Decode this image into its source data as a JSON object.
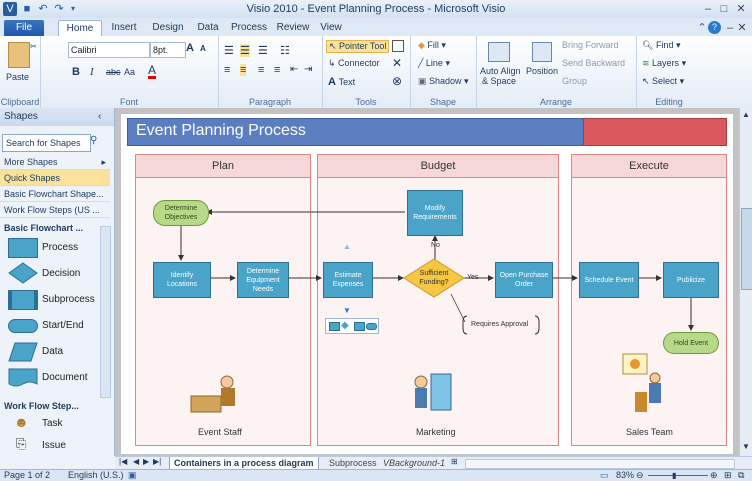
{
  "window": {
    "title": "Visio 2010 - Event Planning Process - Microsoft Visio"
  },
  "ribbon_tabs": [
    "File",
    "Home",
    "Insert",
    "Design",
    "Data",
    "Process",
    "Review",
    "View"
  ],
  "ribbon": {
    "clipboard": {
      "label": "Clipboard",
      "paste": "Paste"
    },
    "font": {
      "label": "Font",
      "family": "Calibri",
      "size": "8pt.",
      "bold": "B",
      "italic": "I",
      "strike": "abc",
      "case": "Aa",
      "color": "A",
      "grow": "A",
      "shrink": "A"
    },
    "paragraph": {
      "label": "Paragraph"
    },
    "tools": {
      "label": "Tools",
      "pointer": "Pointer Tool",
      "connector": "Connector",
      "text": "Text"
    },
    "shape": {
      "label": "Shape",
      "fill": "Fill",
      "line": "Line",
      "shadow": "Shadow"
    },
    "arrange": {
      "label": "Arrange",
      "auto_align": "Auto Align",
      "auto_align2": "& Space",
      "position": "Position",
      "bring_forward": "Bring Forward",
      "send_backward": "Send Backward",
      "group": "Group"
    },
    "editing": {
      "label": "Editing",
      "find": "Find",
      "layers": "Layers",
      "select": "Select"
    }
  },
  "shapes_panel": {
    "title": "Shapes",
    "search_placeholder": "Search for Shapes",
    "nav": [
      "More Shapes",
      "Quick Shapes",
      "Basic Flowchart Shape...",
      "Work Flow Steps (US ..."
    ],
    "section1": "Basic Flowchart ...",
    "stencils": [
      "Process",
      "Decision",
      "Subprocess",
      "Start/End",
      "Data",
      "Document"
    ],
    "section2": "Work Flow Step...",
    "stencils2": [
      "Task",
      "Issue"
    ]
  },
  "diagram": {
    "title": "Event Planning Process",
    "lanes": [
      "Plan",
      "Budget",
      "Execute"
    ],
    "shapes": {
      "determine_objectives": "Determine Objectives",
      "identify_locations": "Identify Locations",
      "determine_equipment": "Determine Equipment Needs",
      "estimate_expenses": "Estimate Expenses",
      "sufficient_funding": "Sufficient Funding?",
      "modify_requirements": "Modify Requirements",
      "open_purchase_order": "Open Purchase Order",
      "schedule_event": "Schedule Event",
      "publicize": "Publicize",
      "hold_event": "Hold Event"
    },
    "connector_labels": {
      "no": "No",
      "yes": "Yes",
      "requires_approval": "Requires Approval"
    },
    "lane_footers": [
      "Event Staff",
      "Marketing",
      "Sales Team"
    ]
  },
  "page_tabs": [
    "Containers in a process diagram",
    "Subprocess",
    "VBackground-1"
  ],
  "status": {
    "page": "Page 1 of 2",
    "language": "English (U.S.)",
    "zoom": "83%"
  },
  "colors": {
    "header_bar": "#5b7ec1",
    "header_accent": "#d9595e",
    "process": "#4aa3c9",
    "decision": "#f6c744",
    "terminator": "#b8d98a"
  }
}
